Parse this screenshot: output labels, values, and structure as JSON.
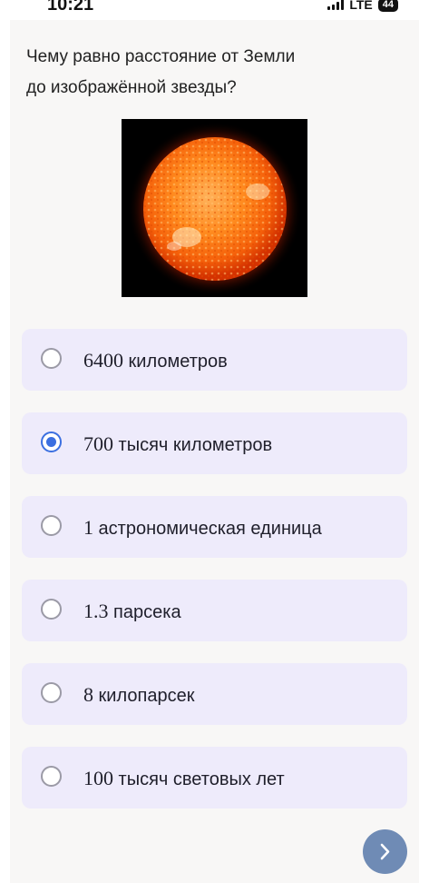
{
  "status_bar": {
    "time": "10:21",
    "network": "LTE",
    "battery": "44"
  },
  "question": {
    "line1": "Чему равно расстояние от Земли",
    "line2": "до изображённой звезды?"
  },
  "image": {
    "subject": "star"
  },
  "options": [
    {
      "num": "6400",
      "text": " километров",
      "selected": false
    },
    {
      "num": "700",
      "text": " тысяч километров",
      "selected": true
    },
    {
      "num": "1",
      "text": " астрономическая единица",
      "selected": false
    },
    {
      "num": "1.3",
      "text": " парсека",
      "selected": false
    },
    {
      "num": "8",
      "text": " килопарсек",
      "selected": false
    },
    {
      "num": "100",
      "text": " тысяч световых лет",
      "selected": false
    }
  ],
  "colors": {
    "option_bg": "#eeebfb",
    "radio_selected": "#3b6fe0",
    "next_button": "#6f8bb5"
  },
  "icons": {
    "next": "chevron-right-icon",
    "signal": "signal-icon",
    "battery": "battery-icon"
  }
}
